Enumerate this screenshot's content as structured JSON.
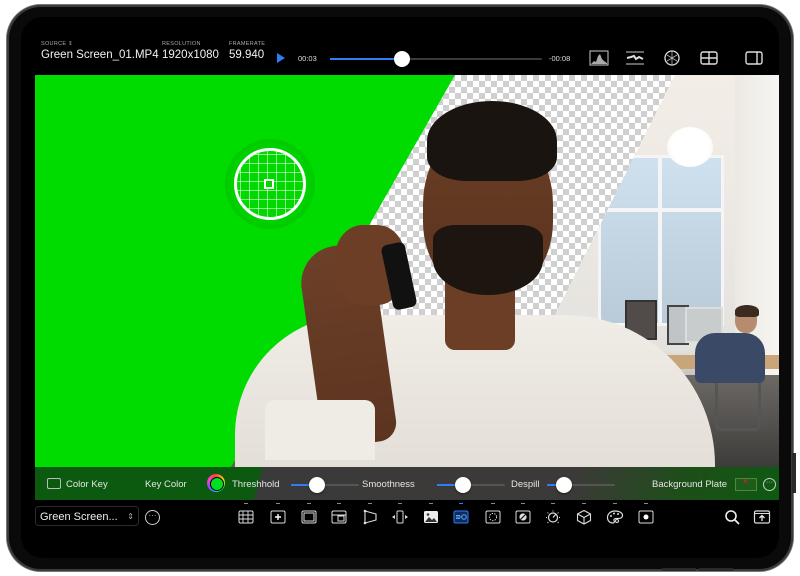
{
  "header": {
    "source_label": "SOURCE",
    "source_value": "Green Screen_01.MP4",
    "resolution_label": "RESOLUTION",
    "resolution_value": "1920x1080",
    "framerate_label": "FRAMERATE",
    "framerate_value": "59.940",
    "elapsed": "00:03",
    "remaining": "-00:08",
    "playback_progress": 0.34,
    "icons": [
      "histogram-icon",
      "waveform-icon",
      "vectorscope-icon",
      "grid-layout-icon",
      "sidebar-toggle-icon"
    ]
  },
  "viewer": {
    "picker": "color-picker-loupe",
    "accent": "#00dc00"
  },
  "controls": {
    "mode_label": "Color Key",
    "key_color_label": "Key Color",
    "key_color": "#00e020",
    "threshold_label": "Threshhold",
    "threshold_value": 0.38,
    "smoothness_label": "Smoothness",
    "smoothness_value": 0.38,
    "despill_label": "Despill",
    "despill_value": 0.25,
    "background_plate_label": "Background Plate"
  },
  "toolbar": {
    "clip_name": "Green Screen...",
    "tools": [
      "grid-icon",
      "add-frame-icon",
      "frame-icon",
      "crop-icon",
      "perspective-icon",
      "transform-icon",
      "image-icon",
      "color-key-icon",
      "mask-icon",
      "no-entry-icon",
      "adjust-dial-icon",
      "3d-cube-icon",
      "palette-icon",
      "vignette-icon"
    ],
    "active_tool": "color-key-icon",
    "accent": "#2f7cf6"
  }
}
